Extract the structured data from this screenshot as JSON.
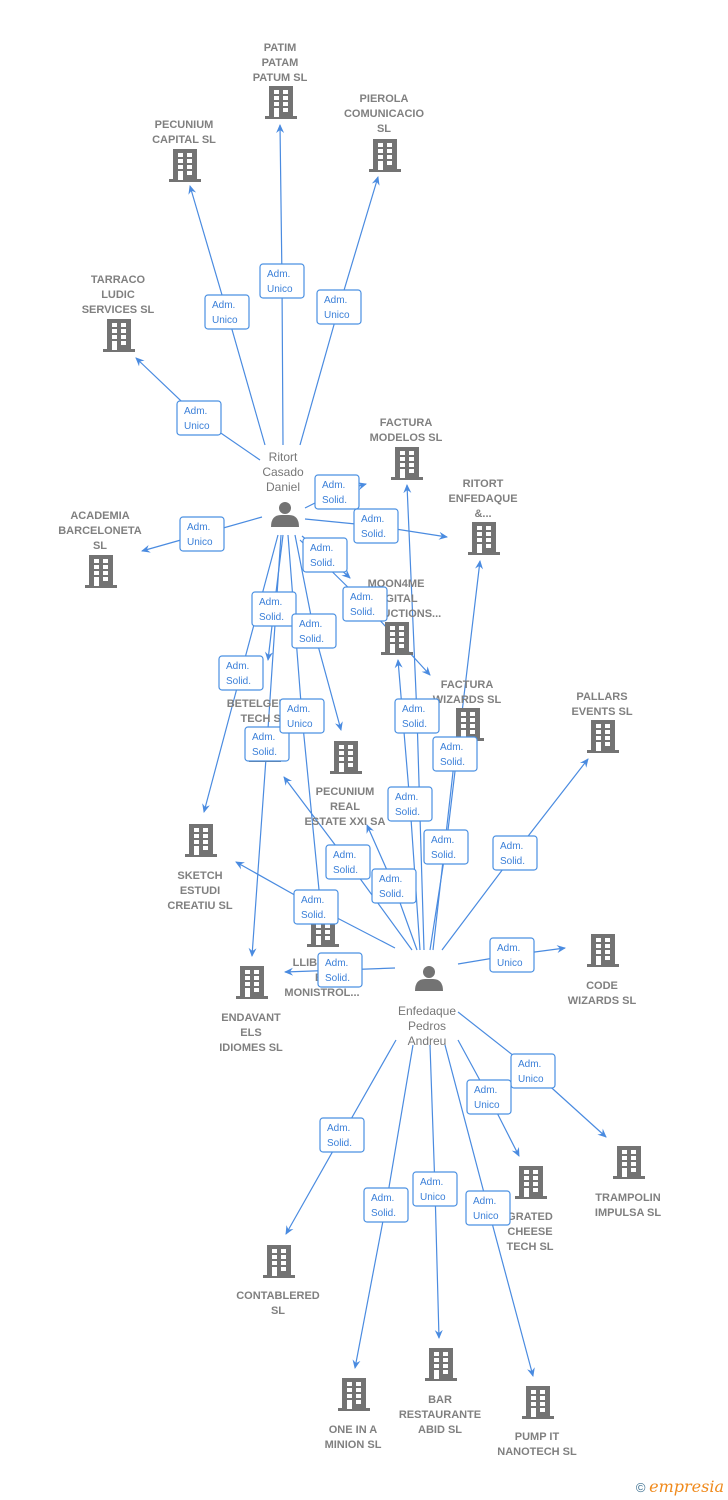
{
  "colors": {
    "edge": "#4a8be0",
    "node": "#737373",
    "label": "#808080"
  },
  "persons": [
    {
      "id": "ritort",
      "lines": [
        "Ritort",
        "Casado",
        "Daniel"
      ],
      "icon": "person-icon"
    },
    {
      "id": "enfedaque",
      "lines": [
        "Enfedaque",
        "Pedros",
        "Andreu"
      ],
      "icon": "person-icon"
    }
  ],
  "companies": [
    {
      "id": "patim",
      "lines": [
        "PATIM",
        "PATAM",
        "PATUM  SL"
      ]
    },
    {
      "id": "pecunium_capital",
      "lines": [
        "PECUNIUM",
        "CAPITAL  SL"
      ]
    },
    {
      "id": "pierola",
      "lines": [
        "PIEROLA",
        "COMUNICACIO",
        "SL"
      ]
    },
    {
      "id": "tarraco",
      "lines": [
        "TARRACO",
        "LUDIC",
        "SERVICES  SL"
      ]
    },
    {
      "id": "academia",
      "lines": [
        "ACADEMIA",
        "BARCELONETA",
        "SL"
      ]
    },
    {
      "id": "factura_modelos",
      "lines": [
        "FACTURA",
        "MODELOS  SL"
      ]
    },
    {
      "id": "ritort_enf",
      "lines": [
        "RITORT",
        "ENFEDAQUE",
        "&..."
      ]
    },
    {
      "id": "moon4me",
      "lines": [
        "MOON4ME",
        "DIGITAL",
        "PRODUCTIONS..."
      ]
    },
    {
      "id": "factura_wizards",
      "lines": [
        "FACTURA",
        "WIZARDS  SL"
      ]
    },
    {
      "id": "pallars",
      "lines": [
        "PALLARS",
        "EVENTS  SL"
      ]
    },
    {
      "id": "betelgeuse",
      "lines": [
        "BETELGEUSE",
        "TECH  SL"
      ]
    },
    {
      "id": "pecunium_real",
      "lines": [
        "PECUNIUM",
        "REAL",
        "ESTATE XXI SA"
      ]
    },
    {
      "id": "sketch",
      "lines": [
        "SKETCH",
        "ESTUDI",
        "CREATIU  SL"
      ]
    },
    {
      "id": "llibre",
      "lines": [
        "LLIBRERIA",
        "EL",
        "MONISTROL..."
      ]
    },
    {
      "id": "endavant",
      "lines": [
        "ENDAVANT",
        "ELS",
        "IDIOMES  SL"
      ]
    },
    {
      "id": "code_wizards",
      "lines": [
        "CODE",
        "WIZARDS  SL"
      ]
    },
    {
      "id": "trampolin",
      "lines": [
        "TRAMPOLIN",
        "IMPULSA  SL"
      ]
    },
    {
      "id": "grated",
      "lines": [
        "GRATED",
        "CHEESE",
        "TECH  SL"
      ]
    },
    {
      "id": "contablered",
      "lines": [
        "CONTABLERED",
        "SL"
      ]
    },
    {
      "id": "one_in_a_minion",
      "lines": [
        "ONE IN A",
        "MINION  SL"
      ]
    },
    {
      "id": "bar",
      "lines": [
        "BAR",
        "RESTAURANTE",
        "ABID  SL"
      ]
    },
    {
      "id": "pump_it",
      "lines": [
        "PUMP IT",
        "NANOTECH  SL"
      ]
    }
  ],
  "edges": [
    {
      "from": "ritort",
      "to": "patim",
      "role": [
        "Adm.",
        "Unico"
      ]
    },
    {
      "from": "ritort",
      "to": "pecunium_capital",
      "role": [
        "Adm.",
        "Unico"
      ]
    },
    {
      "from": "ritort",
      "to": "pierola",
      "role": [
        "Adm.",
        "Unico"
      ]
    },
    {
      "from": "ritort",
      "to": "tarraco",
      "role": [
        "Adm.",
        "Unico"
      ]
    },
    {
      "from": "ritort",
      "to": "academia",
      "role": [
        "Adm.",
        "Unico"
      ]
    },
    {
      "from": "ritort",
      "to": "factura_modelos",
      "role": [
        "Adm.",
        "Solid."
      ]
    },
    {
      "from": "ritort",
      "to": "ritort_enf",
      "role": [
        "Adm.",
        "Solid."
      ]
    },
    {
      "from": "ritort",
      "to": "moon4me",
      "role": [
        "Adm.",
        "Solid."
      ]
    },
    {
      "from": "ritort",
      "to": "factura_wizards",
      "role": [
        "Adm.",
        "Solid."
      ]
    },
    {
      "from": "ritort",
      "to": "betelgeuse",
      "role": [
        "Adm.",
        "Solid."
      ]
    },
    {
      "from": "ritort",
      "to": "pecunium_real",
      "role": [
        "Adm.",
        "Solid."
      ]
    },
    {
      "from": "ritort",
      "to": "sketch",
      "role": [
        "Adm.",
        "Solid."
      ]
    },
    {
      "from": "ritort",
      "to": "endavant",
      "role": [
        "Adm.",
        "Solid."
      ]
    },
    {
      "from": "ritort",
      "to": "llibre",
      "role": [
        "Adm.",
        "Unico"
      ]
    },
    {
      "from": "enfedaque",
      "to": "moon4me",
      "role": [
        "Adm.",
        "Solid."
      ]
    },
    {
      "from": "enfedaque",
      "to": "factura_modelos",
      "role": [
        "Adm.",
        "Solid."
      ]
    },
    {
      "from": "enfedaque",
      "to": "ritort_enf",
      "role": [
        "Adm.",
        "Solid."
      ]
    },
    {
      "from": "enfedaque",
      "to": "factura_wizards",
      "role": [
        "Adm.",
        "Solid."
      ]
    },
    {
      "from": "enfedaque",
      "to": "pallars",
      "role": [
        "Adm.",
        "Solid."
      ]
    },
    {
      "from": "enfedaque",
      "to": "pecunium_real",
      "role": [
        "Adm.",
        "Solid."
      ]
    },
    {
      "from": "enfedaque",
      "to": "betelgeuse",
      "role": [
        "Adm.",
        "Solid."
      ]
    },
    {
      "from": "enfedaque",
      "to": "sketch",
      "role": [
        "Adm.",
        "Solid."
      ]
    },
    {
      "from": "enfedaque",
      "to": "endavant",
      "role": [
        "Adm.",
        "Solid."
      ]
    },
    {
      "from": "enfedaque",
      "to": "code_wizards",
      "role": [
        "Adm.",
        "Unico"
      ]
    },
    {
      "from": "enfedaque",
      "to": "trampolin",
      "role": [
        "Adm.",
        "Unico"
      ]
    },
    {
      "from": "enfedaque",
      "to": "grated",
      "role": [
        "Adm.",
        "Unico"
      ]
    },
    {
      "from": "enfedaque",
      "to": "contablered",
      "role": [
        "Adm.",
        "Solid."
      ]
    },
    {
      "from": "enfedaque",
      "to": "one_in_a_minion",
      "role": [
        "Adm.",
        "Solid."
      ]
    },
    {
      "from": "enfedaque",
      "to": "bar",
      "role": [
        "Adm.",
        "Unico"
      ]
    },
    {
      "from": "enfedaque",
      "to": "pump_it",
      "role": [
        "Adm.",
        "Unico"
      ]
    }
  ],
  "footer": {
    "copyright": "©",
    "brand": "empresia"
  }
}
